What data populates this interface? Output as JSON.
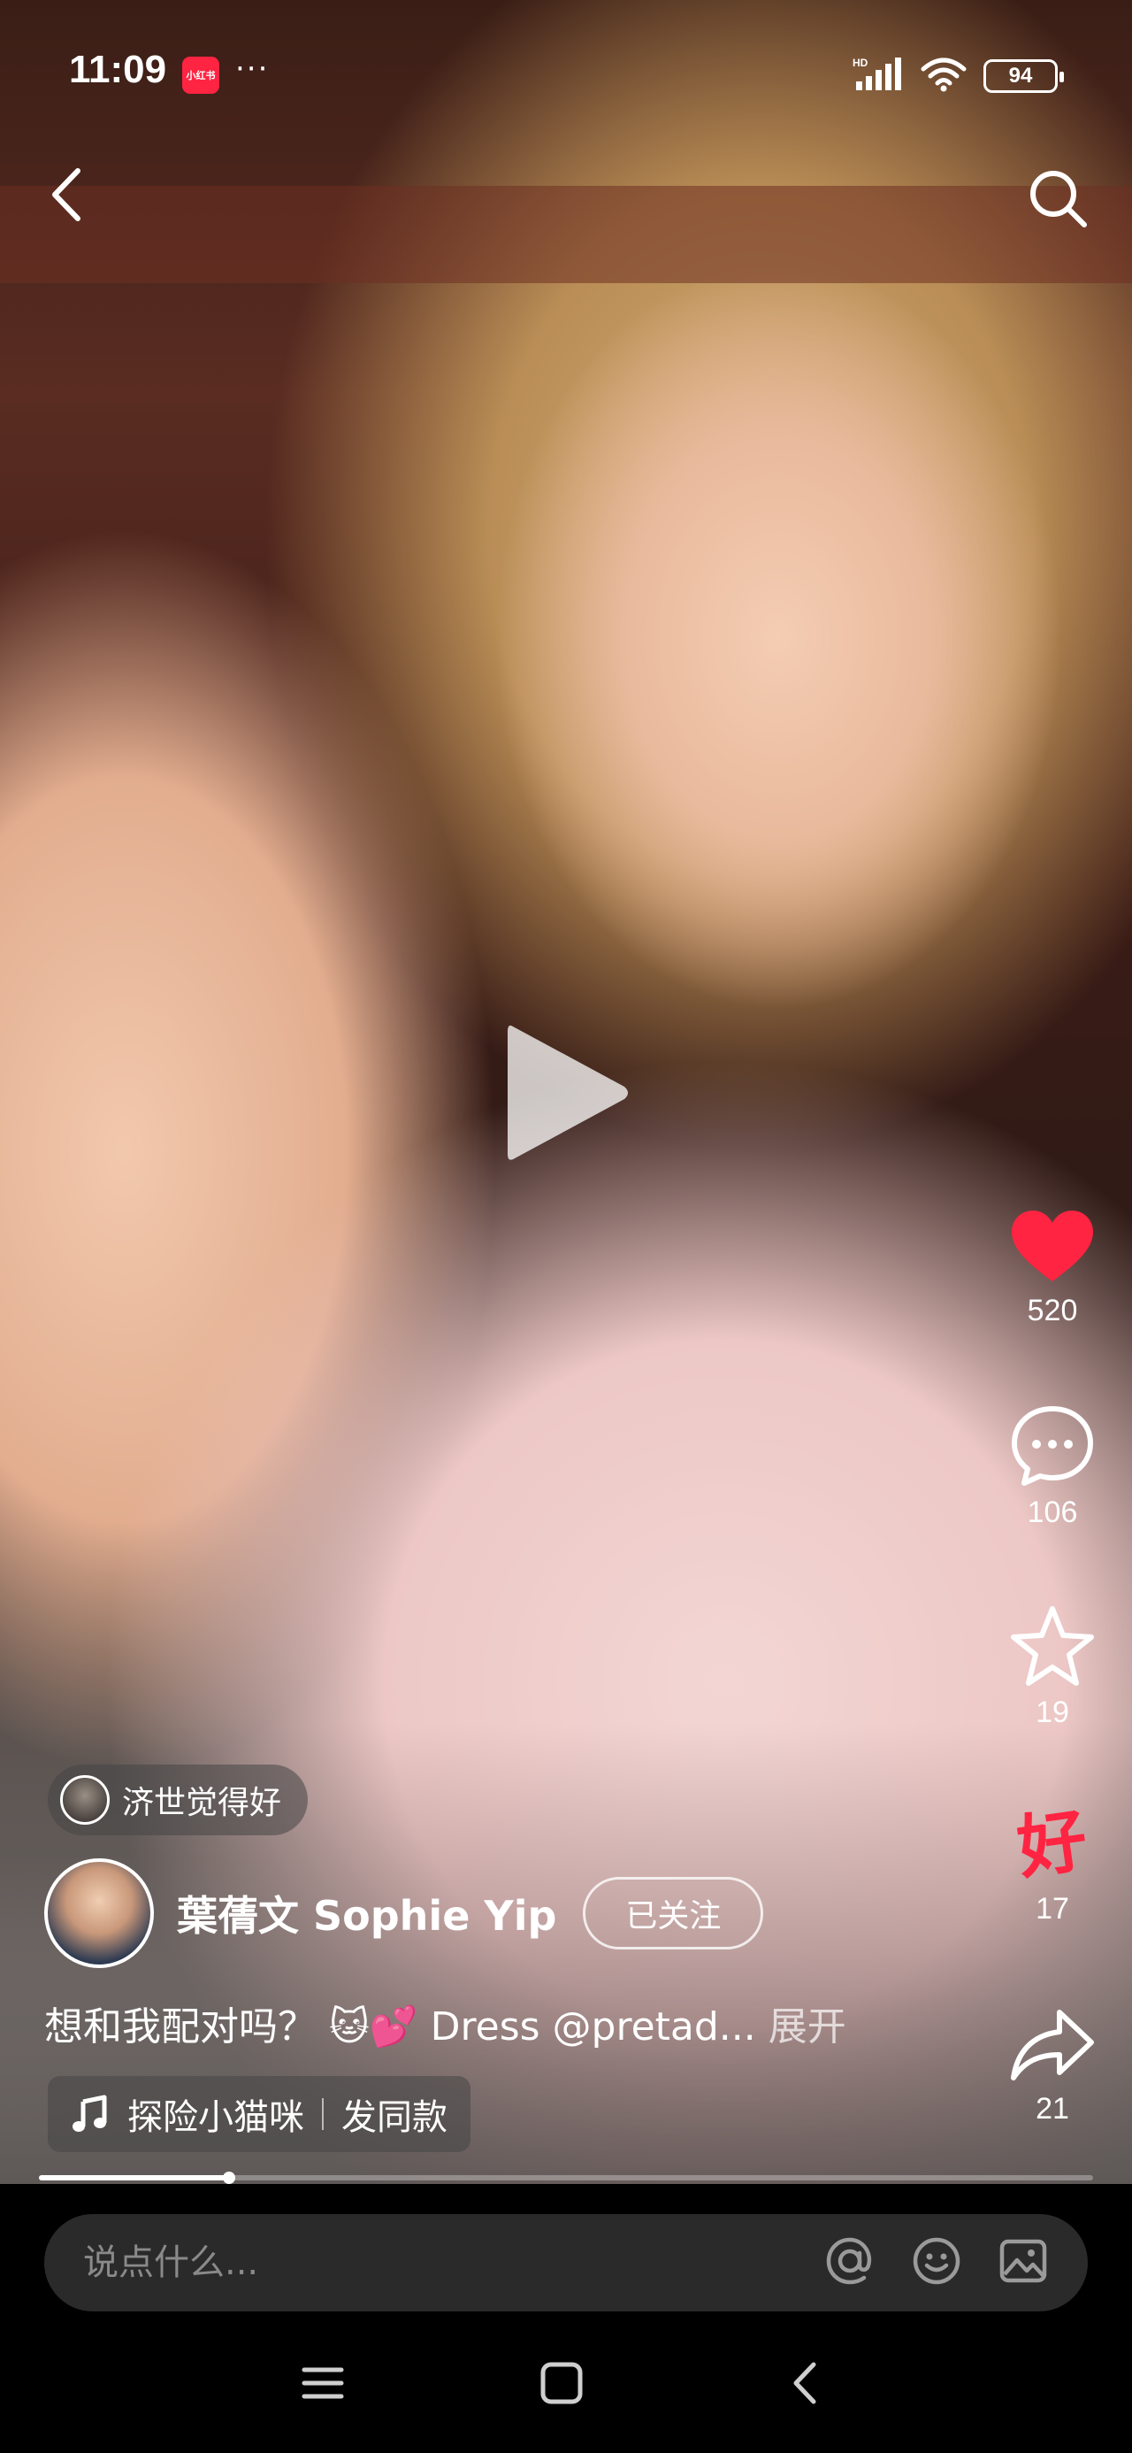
{
  "status_bar": {
    "time": "11:09",
    "app_badge": "小红书",
    "dots": "···",
    "network": "HD",
    "battery": "94"
  },
  "video": {
    "progress": 0.18
  },
  "actions": {
    "like_count": "520",
    "comment_count": "106",
    "collect_count": "19",
    "hao_label": "好",
    "hao_count": "17",
    "share_count": "21"
  },
  "liker": {
    "text": "济世觉得好"
  },
  "author": {
    "name": "葉蒨文 Sophie Yip",
    "follow_label": "已关注"
  },
  "caption": {
    "text": "想和我配对吗？ 🐱💕 Dress @pretad...",
    "more": "展开"
  },
  "music": {
    "title": "探险小猫咪",
    "action": "发同款"
  },
  "comment": {
    "placeholder": "说点什么..."
  },
  "colors": {
    "accent": "#ff2442",
    "comment_bar": "#2a2a2a"
  }
}
